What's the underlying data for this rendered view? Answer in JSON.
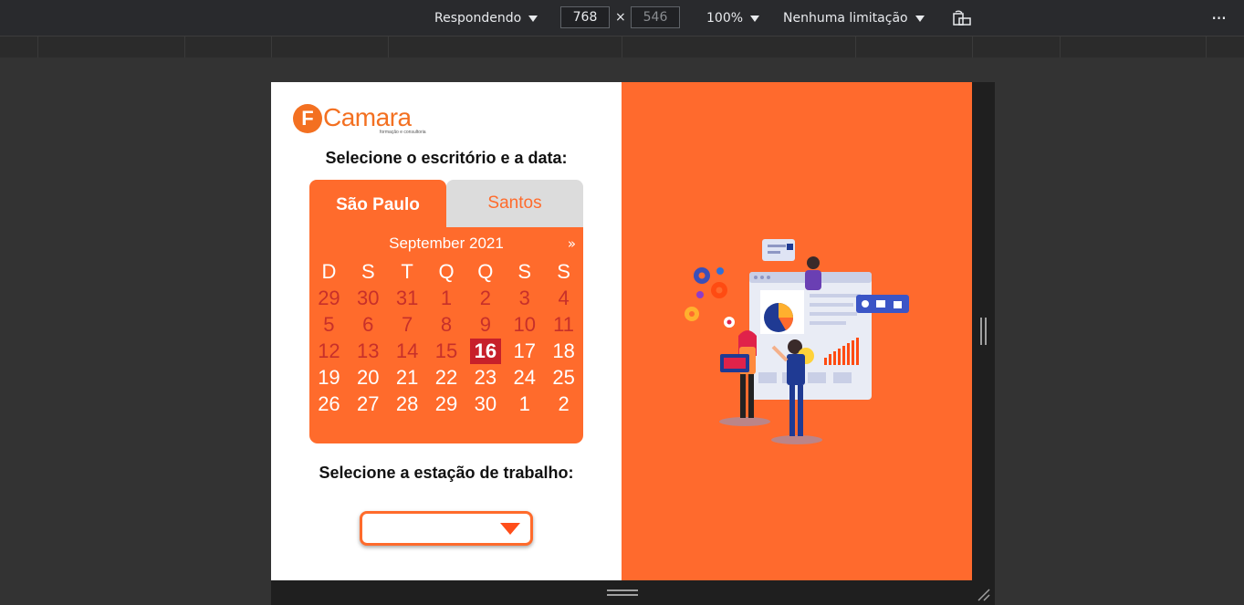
{
  "devtools": {
    "device_label": "Respondendo",
    "width_value": "768",
    "height_value": "546",
    "times_symbol": "×",
    "zoom_label": "100%",
    "throttle_label": "Nenhuma limitação",
    "more_glyph": "⋮"
  },
  "page": {
    "logo": {
      "mark": "F",
      "word": "Camara",
      "tagline": "formação e consultoria"
    },
    "office_heading": "Selecione o escritório e a data:",
    "tabs": [
      {
        "label": "São Paulo",
        "active": true
      },
      {
        "label": "Santos",
        "active": false
      }
    ],
    "calendar": {
      "month_label": "September 2021",
      "next_label": "»",
      "weekday_headers": [
        "D",
        "S",
        "T",
        "Q",
        "Q",
        "S",
        "S"
      ],
      "weeks": [
        [
          "29",
          "30",
          "31",
          "1",
          "2",
          "3",
          "4"
        ],
        [
          "5",
          "6",
          "7",
          "8",
          "9",
          "10",
          "11"
        ],
        [
          "12",
          "13",
          "14",
          "15",
          "16",
          "17",
          "18"
        ],
        [
          "19",
          "20",
          "21",
          "22",
          "23",
          "24",
          "25"
        ],
        [
          "26",
          "27",
          "28",
          "29",
          "30",
          "1",
          "2"
        ]
      ],
      "selected_day": "16"
    },
    "workstation_heading": "Selecione a estação de trabalho:",
    "workstation_value": ""
  },
  "colors": {
    "brand_orange": "#ff6b2c",
    "selected_red": "#c7202a",
    "muted_red": "#c7302a",
    "devtools_bg": "#292a2d"
  }
}
